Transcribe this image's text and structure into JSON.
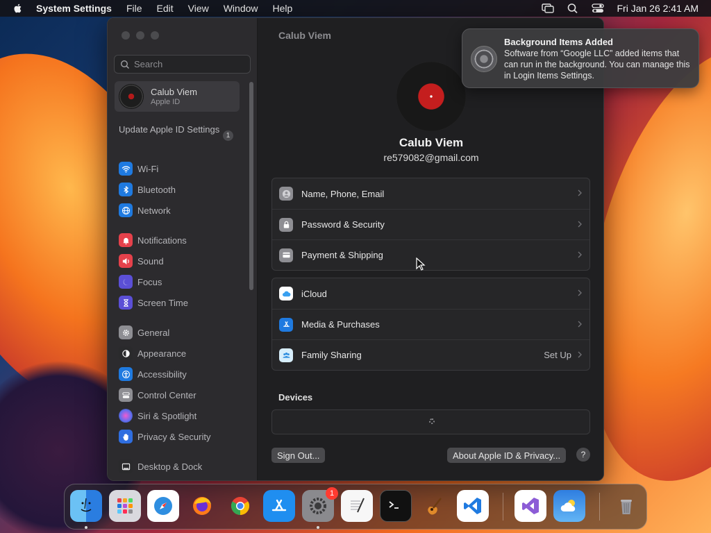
{
  "menubar": {
    "app_name": "System Settings",
    "items": [
      "File",
      "Edit",
      "View",
      "Window",
      "Help"
    ],
    "clock": "Fri Jan 26  2:41 AM"
  },
  "sidebar": {
    "search_placeholder": "Search",
    "account": {
      "name": "Calub Viem",
      "subtitle": "Apple ID"
    },
    "update": {
      "label": "Update Apple ID Settings",
      "badge": "1"
    },
    "items": [
      {
        "label": "Wi-Fi",
        "icon": "wifi-icon",
        "color": "#1f7ae0"
      },
      {
        "label": "Bluetooth",
        "icon": "bluetooth-icon",
        "color": "#1f7ae0"
      },
      {
        "label": "Network",
        "icon": "globe-icon",
        "color": "#1f7ae0"
      },
      {
        "label": "Notifications",
        "icon": "bell-icon",
        "color": "#e5414b"
      },
      {
        "label": "Sound",
        "icon": "speaker-icon",
        "color": "#e5414b"
      },
      {
        "label": "Focus",
        "icon": "moon-icon",
        "color": "#5b4fd6"
      },
      {
        "label": "Screen Time",
        "icon": "hourglass-icon",
        "color": "#5b4fd6"
      },
      {
        "label": "General",
        "icon": "gear-icon",
        "color": "#8e8e93"
      },
      {
        "label": "Appearance",
        "icon": "appearance-icon",
        "color": "#2a2a2c"
      },
      {
        "label": "Accessibility",
        "icon": "accessibility-icon",
        "color": "#1f7ae0"
      },
      {
        "label": "Control Center",
        "icon": "control-center-icon",
        "color": "#8e8e93"
      },
      {
        "label": "Siri & Spotlight",
        "icon": "siri-icon",
        "color": "#b84fd6"
      },
      {
        "label": "Privacy & Security",
        "icon": "hand-icon",
        "color": "#2f6ee0"
      },
      {
        "label": "Desktop & Dock",
        "icon": "dock-icon",
        "color": "#2a2a2c"
      }
    ]
  },
  "main": {
    "title": "Calub Viem",
    "profile": {
      "name": "Calub Viem",
      "email": "re579082@gmail.com"
    },
    "group1": [
      {
        "label": "Name, Phone, Email",
        "icon": "person-icon",
        "color": "#8e8e93"
      },
      {
        "label": "Password & Security",
        "icon": "lock-icon",
        "color": "#8e8e93"
      },
      {
        "label": "Payment & Shipping",
        "icon": "card-icon",
        "color": "#8e8e93"
      }
    ],
    "group2": [
      {
        "label": "iCloud",
        "icon": "cloud-icon",
        "color": "#ffffff",
        "value": ""
      },
      {
        "label": "Media & Purchases",
        "icon": "app-store-icon",
        "color": "#1f7ae0",
        "value": ""
      },
      {
        "label": "Family Sharing",
        "icon": "family-icon",
        "color": "#d7eefb",
        "value": "Set Up"
      }
    ],
    "devices_heading": "Devices",
    "sign_out": "Sign Out...",
    "about": "About Apple ID & Privacy...",
    "help": "?"
  },
  "notification": {
    "title": "Background Items Added",
    "body": "Software from “Google LLC” added items that can run in the background. You can manage this in Login Items Settings."
  },
  "dock": {
    "settings_badge": "1",
    "apps": [
      "finder-icon",
      "launchpad-icon",
      "safari-icon",
      "firefox-icon",
      "chrome-icon",
      "app-store-icon",
      "system-settings-icon",
      "textedit-icon",
      "terminal-icon",
      "garageband-icon",
      "vscode-icon",
      "visual-studio-icon",
      "weather-icon",
      "trash-icon"
    ]
  }
}
